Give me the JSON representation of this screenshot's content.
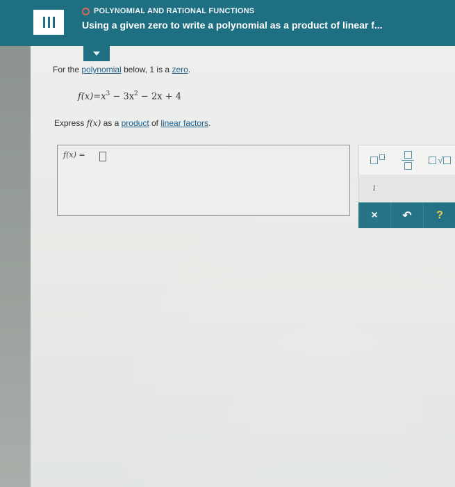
{
  "header": {
    "menu_icon": "hamburger-icon",
    "topic": "POLYNOMIAL AND RATIONAL FUNCTIONS",
    "title": "Using a given zero to write a polynomial as a product of linear f..."
  },
  "collapse_icon": "caret-down-icon",
  "problem": {
    "prompt_before": "For the ",
    "prompt_link_polynomial": "polynomial",
    "prompt_middle": " below, 1 is a ",
    "prompt_link_zero": "zero",
    "prompt_end": ".",
    "equation": {
      "lhs": "f(x)",
      "eq": "=",
      "t1": "x",
      "t1_exp": "3",
      "t2": " − 3x",
      "t2_exp": "2",
      "t3": " − 2x + 4"
    },
    "instruction_before": "Express ",
    "instruction_fx": "f(x)",
    "instruction_middle": " as a ",
    "instruction_link_product": "product",
    "instruction_of": " of ",
    "instruction_link_linear": "linear factors",
    "instruction_end": "."
  },
  "answer": {
    "label": "f(x) ="
  },
  "keypad": {
    "superscript_icon": "superscript-template-icon",
    "fraction_icon": "fraction-template-icon",
    "sqrt_icon": "sqrt-template-icon",
    "imaginary_label": "i",
    "clear_label": "×",
    "undo_label": "↶",
    "help_label": "?"
  },
  "colors": {
    "header_bg": "#1f6f82",
    "accent_ring": "#e56a54",
    "link": "#1f5f8a"
  }
}
